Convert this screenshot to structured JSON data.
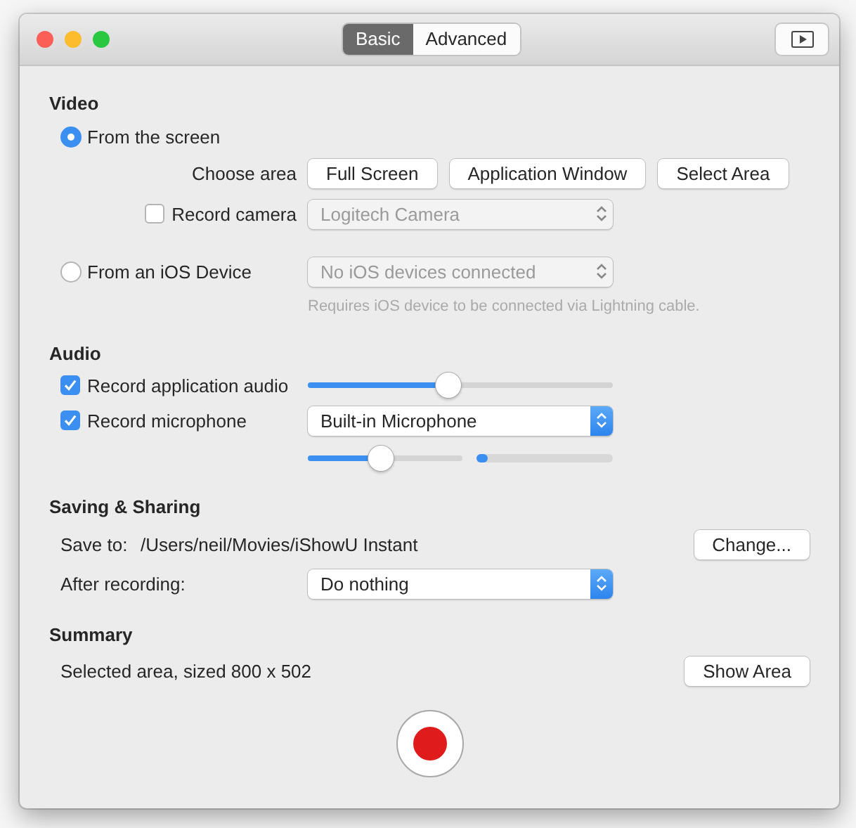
{
  "window": {
    "tabs": [
      {
        "label": "Basic",
        "selected": true
      },
      {
        "label": "Advanced",
        "selected": false
      }
    ]
  },
  "video": {
    "heading": "Video",
    "screen_source": {
      "label": "From the screen",
      "selected": true
    },
    "choose_area": {
      "label": "Choose area",
      "buttons": [
        "Full Screen",
        "Application Window",
        "Select Area"
      ]
    },
    "record_camera": {
      "label": "Record camera",
      "checked": false,
      "popup": {
        "value": "Logitech Camera",
        "disabled": true
      }
    },
    "ios_source": {
      "label": "From an iOS Device",
      "selected": false,
      "popup": {
        "value": "No iOS devices connected",
        "disabled": true
      }
    },
    "hint": "Requires iOS device to be connected via Lightning cable."
  },
  "audio": {
    "heading": "Audio",
    "app_audio": {
      "label": "Record application audio",
      "checked": true,
      "volume": {
        "level": 0.46
      }
    },
    "microphone": {
      "label": "Record microphone",
      "checked": true,
      "popup": {
        "value": "Built-in Microphone",
        "disabled": false
      },
      "volume": {
        "level": 0.47
      },
      "meter": {
        "level": 0.08
      }
    }
  },
  "saving": {
    "heading": "Saving & Sharing",
    "save_to_label": "Save to:",
    "path": "/Users/neil/Movies/iShowU Instant",
    "change_button": "Change...",
    "after_label": "After recording:",
    "after_popup": {
      "value": "Do nothing",
      "disabled": false
    }
  },
  "summary": {
    "heading": "Summary",
    "text": "Selected area, sized 800 x 502",
    "button": "Show Area"
  }
}
